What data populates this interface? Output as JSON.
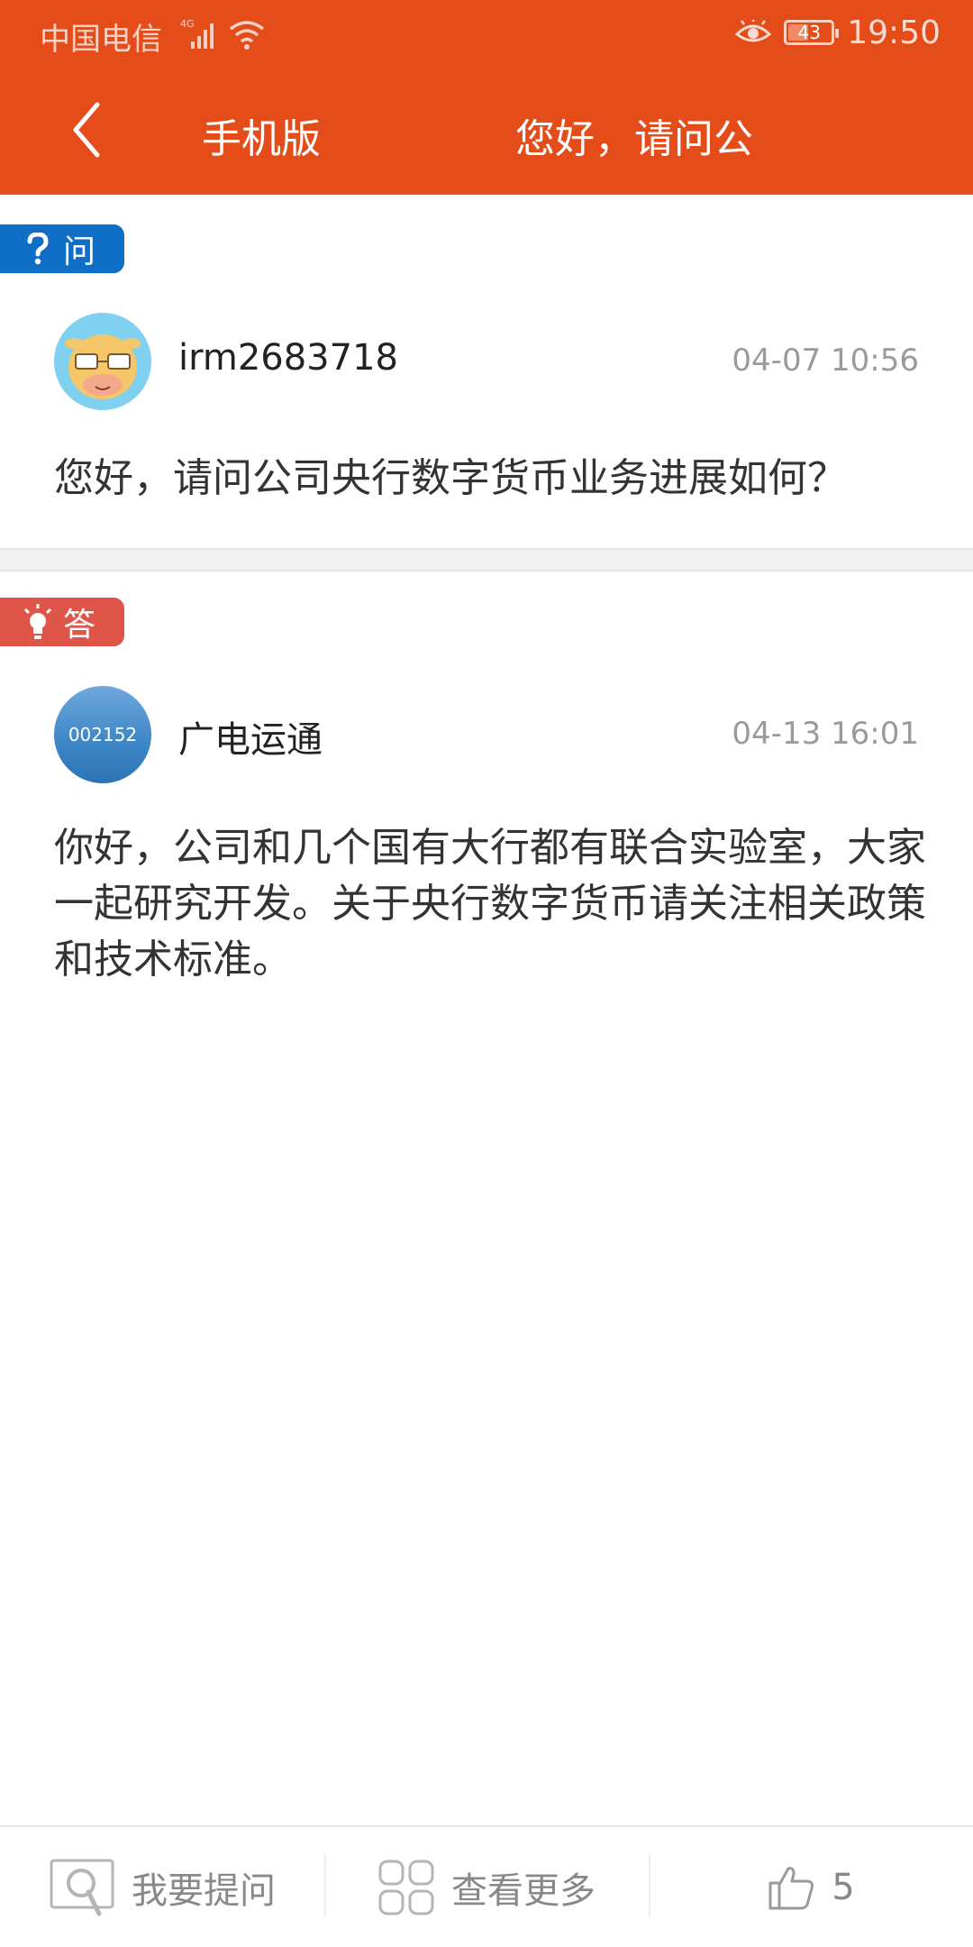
{
  "status_bar": {
    "carrier": "中国电信",
    "network": "4G",
    "battery": "43",
    "battery_level": 0.43,
    "time": "19:50"
  },
  "nav": {
    "left_label": "手机版",
    "title": "您好，请问公"
  },
  "question": {
    "tag": "问",
    "user": "irm2683718",
    "date": "04-07 10:56",
    "text": "您好，请问公司央行数字货币业务进展如何？"
  },
  "answer": {
    "tag": "答",
    "avatar_code": "002152",
    "company": "广电运通",
    "date": "04-13 16:01",
    "text": "你好，公司和几个国有大行都有联合实验室，大家一起研究开发。关于央行数字货币请关注相关政策和技术标准。"
  },
  "bottom_bar": {
    "ask_label": "我要提问",
    "more_label": "查看更多",
    "like_count": "5"
  },
  "colors": {
    "header": "#e44d1a",
    "question_tag": "#0f6fc7",
    "answer_tag": "#e0554a"
  },
  "icons": {
    "back": "back-arrow-icon",
    "question": "question-mark-icon",
    "answer": "lightbulb-icon",
    "ask": "search-question-icon",
    "more": "grid-icon",
    "like": "thumbs-up-icon"
  }
}
